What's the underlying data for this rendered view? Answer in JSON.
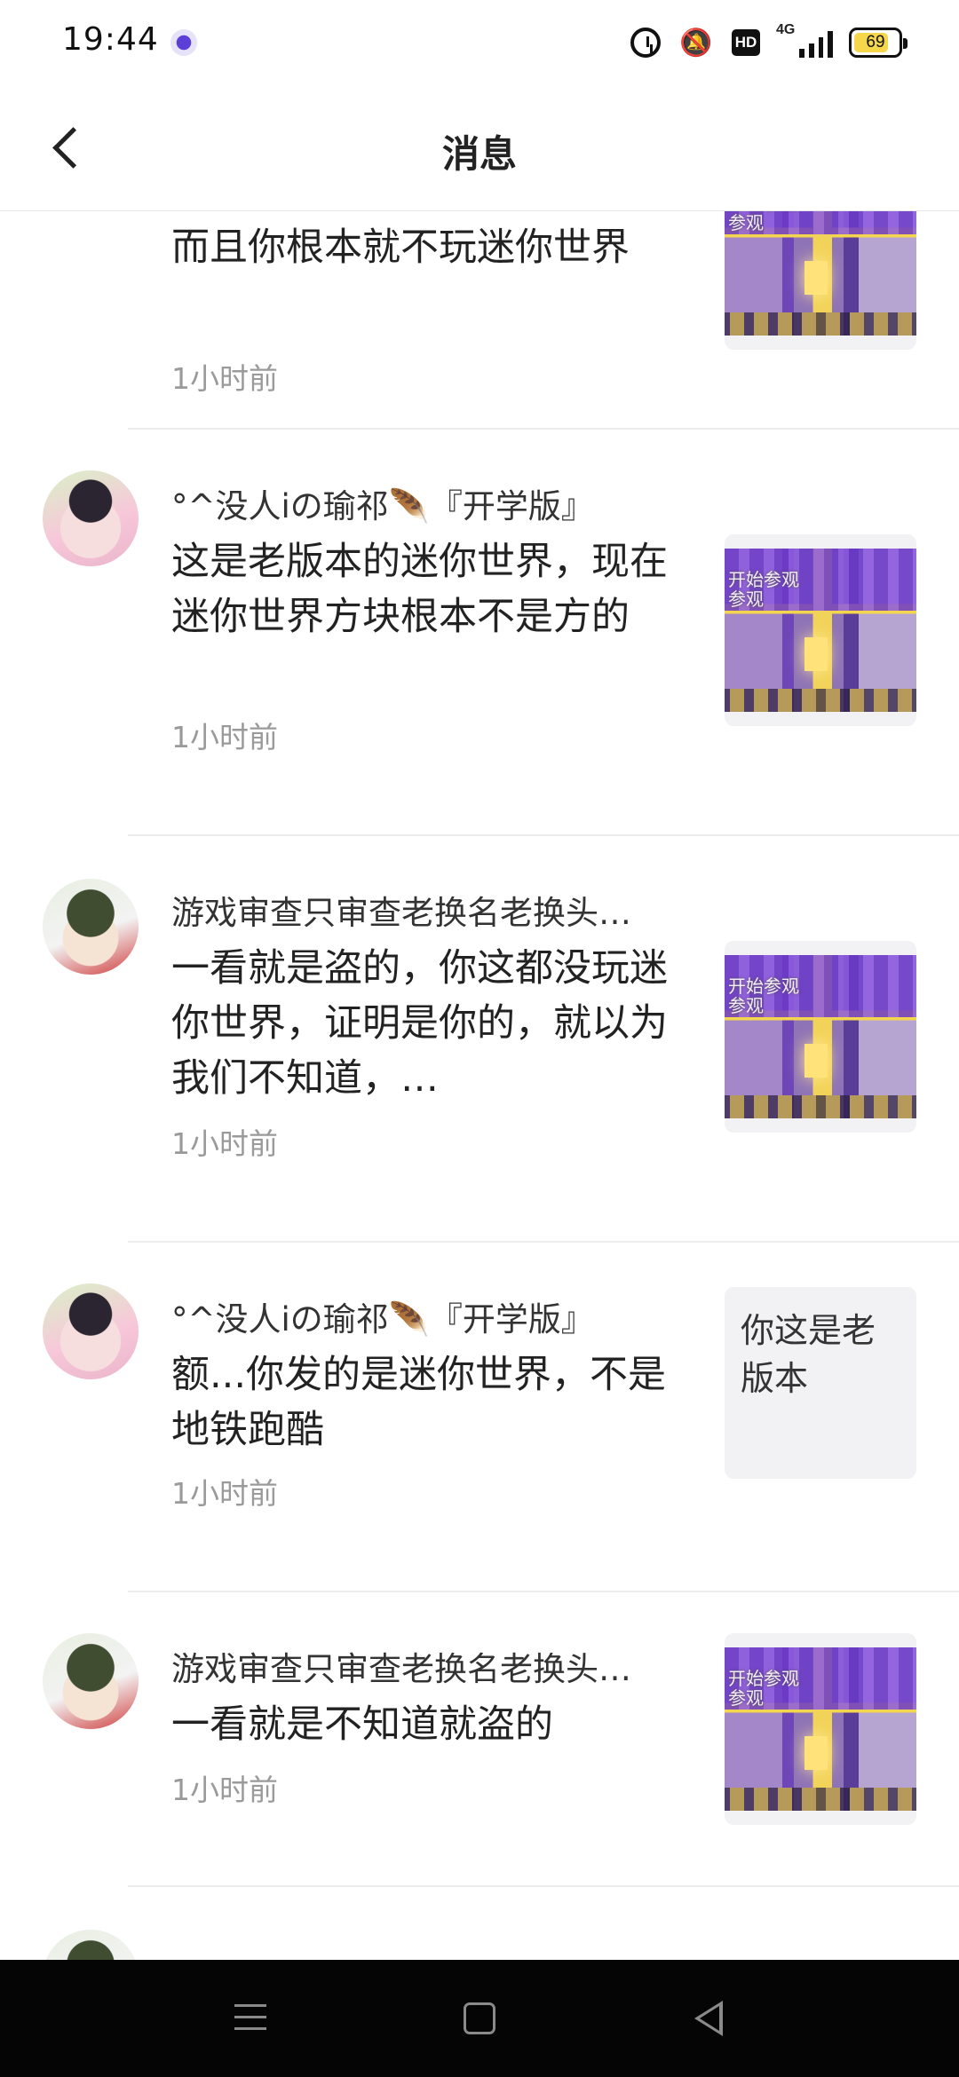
{
  "status_bar": {
    "time": "19:44",
    "network": "4G",
    "hd": "HD",
    "battery": "69",
    "icons": [
      "app-notification-icon",
      "alarm-icon",
      "mute-vibrate-icon",
      "hd-icon",
      "signal-icon",
      "battery-icon"
    ]
  },
  "header": {
    "title": "消息",
    "back_icon": "chevron-left-icon"
  },
  "messages": [
    {
      "author": "",
      "comment": "而且你根本就不玩迷你世界",
      "time": "1小时前",
      "preview_type": "image",
      "preview_overlay": "开始参观\n参观"
    },
    {
      "author": "°^没人i⁠の瑜祁🪶『开学版』",
      "comment": "这是老版本的迷你世界，现在迷你世界方块根本不是方的",
      "time": "1小时前",
      "preview_type": "image",
      "preview_overlay": "开始参观\n参观"
    },
    {
      "author": "游戏审查只审查老换名老换头…",
      "comment": "一看就是盗的，你这都没玩迷你世界，证明是你的，就以为我们不知道，…",
      "time": "1小时前",
      "preview_type": "image",
      "preview_overlay": "开始参观\n参观"
    },
    {
      "author": "°^没人i⁠の瑜祁🪶『开学版』",
      "comment": "额...你发的是迷你世界，不是地铁跑酷",
      "time": "1小时前",
      "preview_type": "text",
      "preview_text": "你这是老版本"
    },
    {
      "author": "游戏审查只审查老换名老换头…",
      "comment": "一看就是不知道就盗的",
      "time": "1小时前",
      "preview_type": "image",
      "preview_overlay": "开始参观\n参观"
    }
  ],
  "nav_bar": {
    "icons": [
      "menu-icon",
      "home-icon",
      "back-triangle-icon"
    ]
  }
}
